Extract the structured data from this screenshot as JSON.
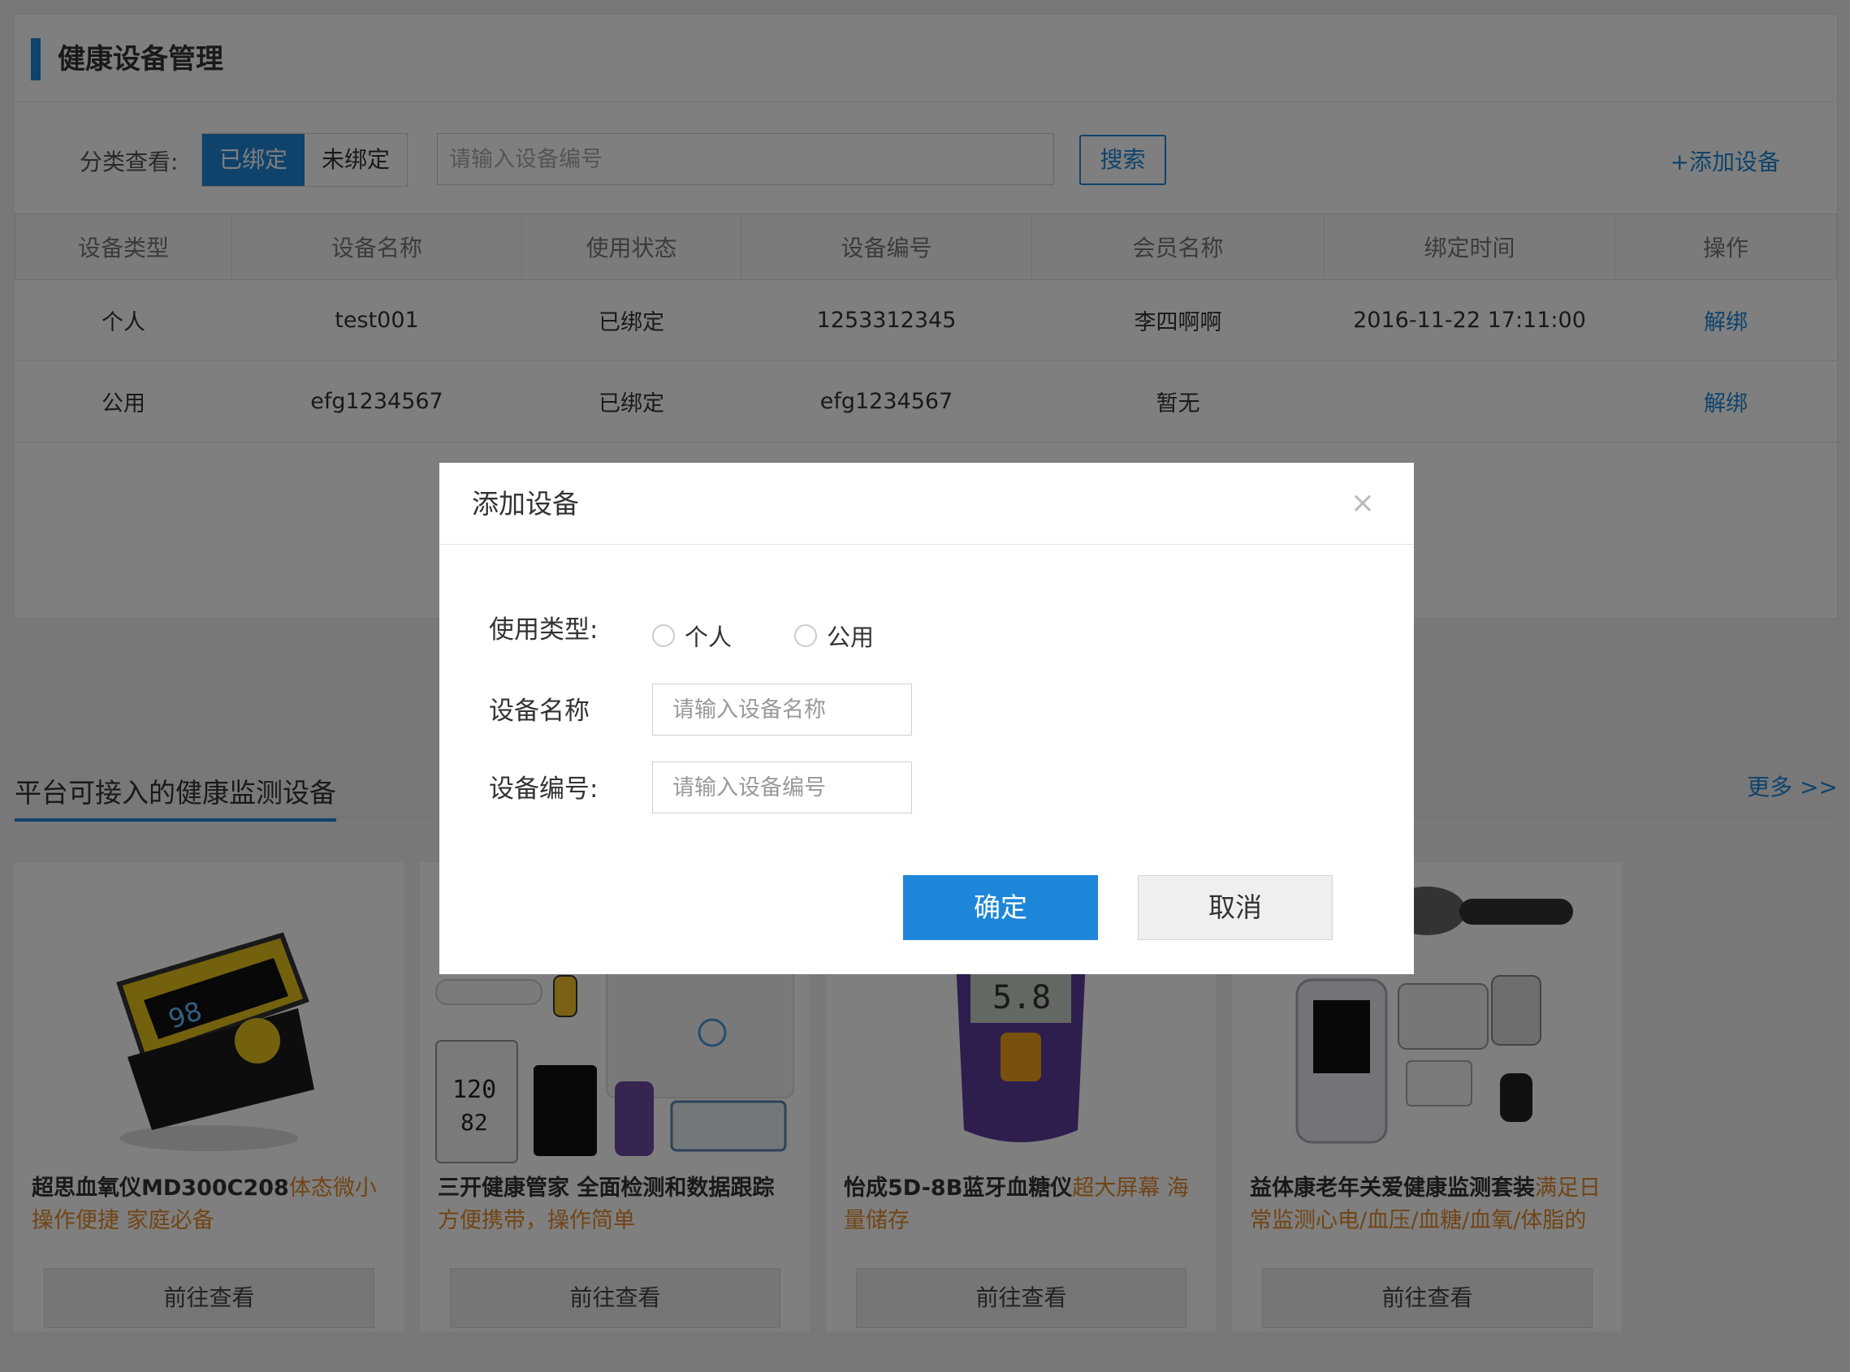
{
  "page": {
    "title": "健康设备管理",
    "filter_label": "分类查看:",
    "tabs": [
      "已绑定",
      "未绑定"
    ],
    "search_placeholder": "请输入设备编号",
    "search_button": "搜索",
    "add_link": "+添加设备"
  },
  "table": {
    "headers": [
      "设备类型",
      "设备名称",
      "使用状态",
      "设备编号",
      "会员名称",
      "绑定时间",
      "操作"
    ],
    "rows": [
      [
        "个人",
        "test001",
        "已绑定",
        "1253312345",
        "李四啊啊",
        "2016-11-22 17:11:00",
        "解绑"
      ],
      [
        "公用",
        "efg1234567",
        "已绑定",
        "efg1234567",
        "暂无",
        "",
        "解绑"
      ]
    ]
  },
  "section": {
    "title": "平台可接入的健康监测设备",
    "more": "更多 >>"
  },
  "cards": [
    {
      "name": "超思血氧仪MD300C208",
      "desc": "体态微小 操作便捷 家庭必备",
      "button": "前往查看"
    },
    {
      "name": "三开健康管家 全面检测和数据跟踪",
      "desc": "方便携带，操作简单",
      "button": "前往查看"
    },
    {
      "name": "怡成5D-8B蓝牙血糖仪",
      "desc": "超大屏幕 海量储存",
      "button": "前往查看"
    },
    {
      "name": "益体康老年关爱健康监测套装",
      "desc": "满足日常监测心电/血压/血糖/血氧/体脂的需",
      "button": "前往查看"
    }
  ],
  "modal": {
    "title": "添加设备",
    "close": "×",
    "type_label": "使用类型:",
    "type_options": [
      "个人",
      "公用"
    ],
    "name_label": "设备名称",
    "name_placeholder": "请输入设备名称",
    "code_label": "设备编号:",
    "code_placeholder": "请输入设备编号",
    "ok": "确定",
    "cancel": "取消"
  },
  "colors": {
    "accent": "#1e86d8",
    "highlight": "#e38a2a"
  }
}
